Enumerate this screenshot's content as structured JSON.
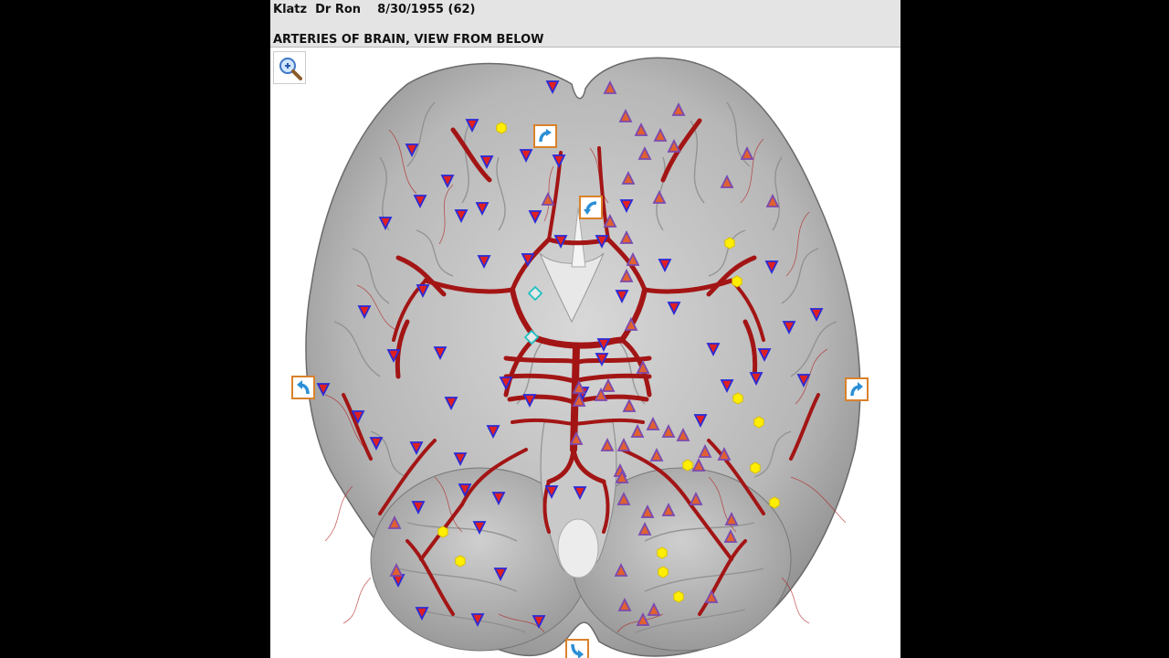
{
  "header": {
    "patient_line": "Klatz  Dr Ron    8/30/1955 (62)",
    "title": "ARTERIES OF BRAIN, VIEW FROM BELOW"
  },
  "toolbar": {
    "zoom_icon": "magnifier-zoom-icon"
  },
  "navigation": {
    "icon": "curved-arrow-icon",
    "border_color": "#d9822b",
    "fill_color": "#2b8fd6"
  },
  "colors": {
    "artery": "#a31515",
    "brain_tissue": "#bdbdbd",
    "down_marker_fill": "#e02020",
    "down_marker_border": "#2a2ad8",
    "up_marker_fill": "#e06030",
    "up_marker_border": "#7a4ab0",
    "hex_marker": "#ffee00",
    "diamond_marker": "#20c0c0"
  }
}
